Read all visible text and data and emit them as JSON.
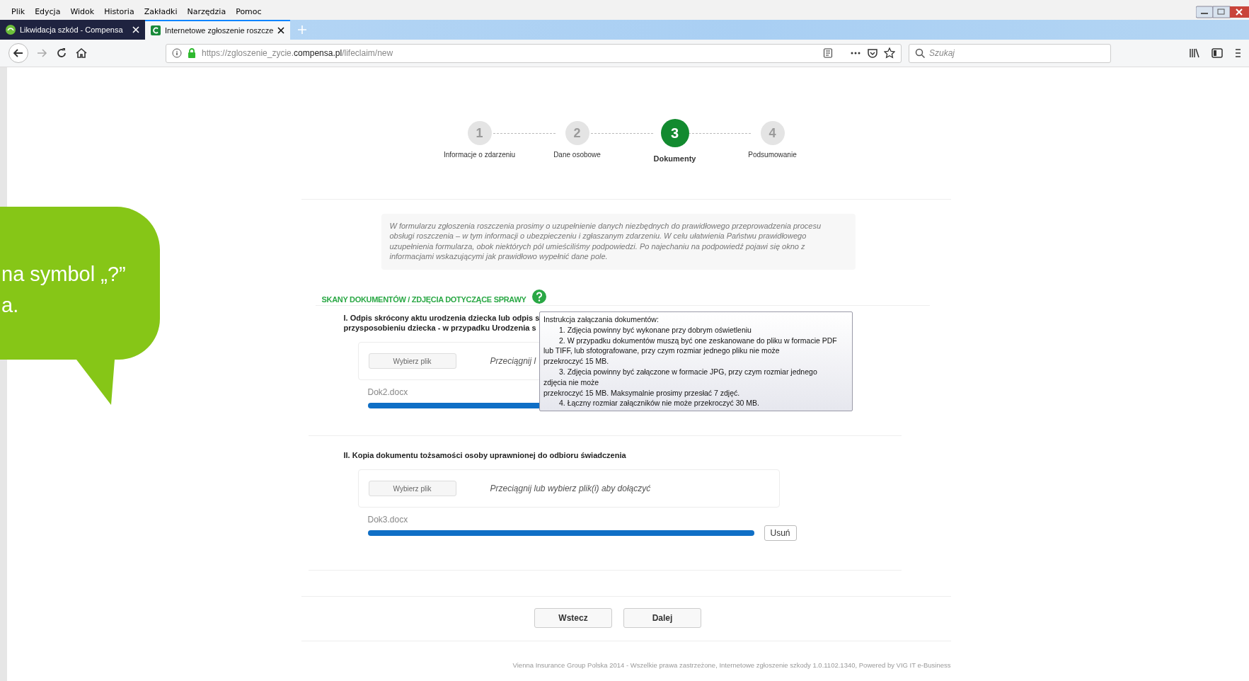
{
  "menu_bar": [
    "Plik",
    "Edycja",
    "Widok",
    "Historia",
    "Zakładki",
    "Narzędzia",
    "Pomoc"
  ],
  "tabs": [
    {
      "label": "Likwidacja szkód - Compensa",
      "selected": false
    },
    {
      "label": "Internetowe zgłoszenie roszcze",
      "selected": true
    }
  ],
  "address_bar": {
    "url": "https://zgloszenie_zycie.**compensa.pl**/lifeclaim/new"
  },
  "search": {
    "placeholder": "Szukaj"
  },
  "stepper": [
    {
      "number": "1",
      "label": "Informacje o zdarzeniu",
      "selected": false
    },
    {
      "number": "2",
      "label": "Dane osobowe",
      "selected": false
    },
    {
      "number": "3",
      "label": "Dokumenty",
      "selected": true
    },
    {
      "number": "4",
      "label": "Podsumowanie",
      "selected": false
    }
  ],
  "intro": "W formularzu zgłoszenia roszczenia prosimy o uzupełnienie danych niezbędnych do prawidłowego przeprowadzenia procesu obsługi roszczenia – w tym informacji o ubezpieczeniu i zgłaszanym zdarzeniu. W celu ułatwienia Państwu prawidłowego uzupełnienia formularza, obok niektórych pól umieściliśmy podpowiedzi. Po najechaniu na  podpowiedź pojawi się okno z informacjami wskazującymi jak prawidłowo wypełnić dane pole.",
  "section_title": "SKANY DOKUMENTÓW / ZDJĘCIA DOTYCZĄCE SPRAWY",
  "tooltip": [
    {
      "kind": "heading",
      "text": "Instrukcja załączania dokumentów:"
    },
    {
      "kind": "item",
      "text": "1. Zdjęcia powinny być wykonane przy dobrym oświetleniu"
    },
    {
      "kind": "item",
      "text": "2. W przypadku dokumentów muszą być one zeskanowane do pliku w formacie PDF"
    },
    {
      "kind": "continuation",
      "text": "lub TIFF, lub sfotografowane, przy czym rozmiar jednego pliku nie może"
    },
    {
      "kind": "continuation",
      "text": "przekroczyć 15 MB."
    },
    {
      "kind": "item",
      "text": "3.  Zdjęcia powinny być załączone w formacie JPG, przy czym rozmiar jednego"
    },
    {
      "kind": "continuation",
      "text": "zdjęcia nie może"
    },
    {
      "kind": "continuation",
      "text": "przekroczyć 15 MB. Maksymalnie prosimy przesłać 7 zdjęć."
    },
    {
      "kind": "item",
      "text": "4. Łączny rozmiar załączników nie może przekroczyć 30 MB."
    }
  ],
  "documents": [
    {
      "title_lines": [
        "I. Odpis skrócony aktu urodzenia dziecka lub odpis s",
        "przysposobieniu dziecka - w przypadku Urodzenia s"
      ],
      "choose_button": "Wybierz plik",
      "drop_hint": "Przeciągnij l",
      "file": "Dok2.docx",
      "level": 1
    },
    {
      "title_lines": [
        "II. Kopia dokumentu tożsamości osoby uprawnionej do odbioru świadczenia"
      ],
      "choose_button": "Wybierz plik",
      "drop_hint": "Przeciągnij lub wybierz plik(i) aby dołączyć",
      "file": "Dok3.docx",
      "level": 1,
      "remove_button": "Usuń"
    }
  ],
  "buttons": [
    "Wstecz",
    "Dalej"
  ],
  "footer": "Vienna Insurance Group Polska 2014 - Wszelkie prawa zastrzeżone, Internetowe zgłoszenie szkody 1.0.1102.1340, Powered by VIG IT e-Business",
  "callout": [
    "na symbol „?”",
    "a."
  ]
}
